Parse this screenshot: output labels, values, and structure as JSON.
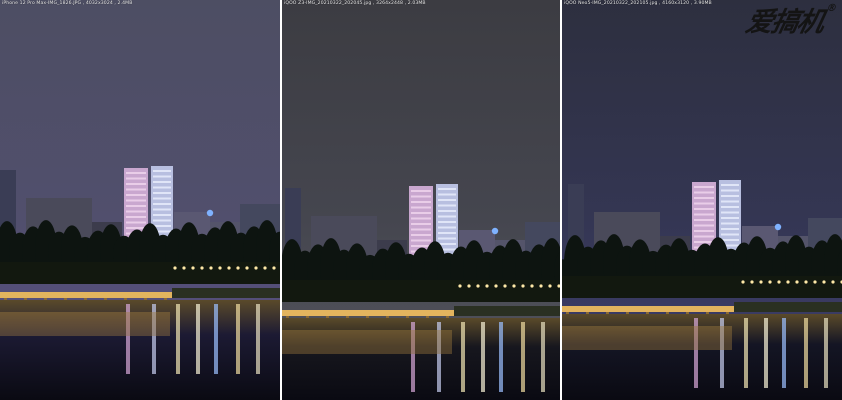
{
  "panels": [
    {
      "caption": "iPhone 12 Pro Max-IMG_1826.JPG  ,  4032x3024  ,  2.4MB",
      "tone": {
        "sky_top": "#4d4e63",
        "sky_mid": "#514f6d",
        "sky_low": "#5a4f8a",
        "water": "#1c1a33"
      }
    },
    {
      "caption": "iQOO Z3-IMG_20210322_202045.jpg  ,  3264x2448  ,  2.03MB",
      "tone": {
        "sky_top": "#3c3c42",
        "sky_mid": "#45464f",
        "sky_low": "#55565f",
        "water": "#17171e"
      }
    },
    {
      "caption": "iQOO Neo5-IMG_20210322_202105.jpg  ,  4160x3120  ,  3.90MB",
      "tone": {
        "sky_top": "#2d2f3f",
        "sky_mid": "#343653",
        "sky_low": "#404072",
        "water": "#141524"
      }
    }
  ],
  "watermark": {
    "text": "爱搞机",
    "mark": "®"
  }
}
